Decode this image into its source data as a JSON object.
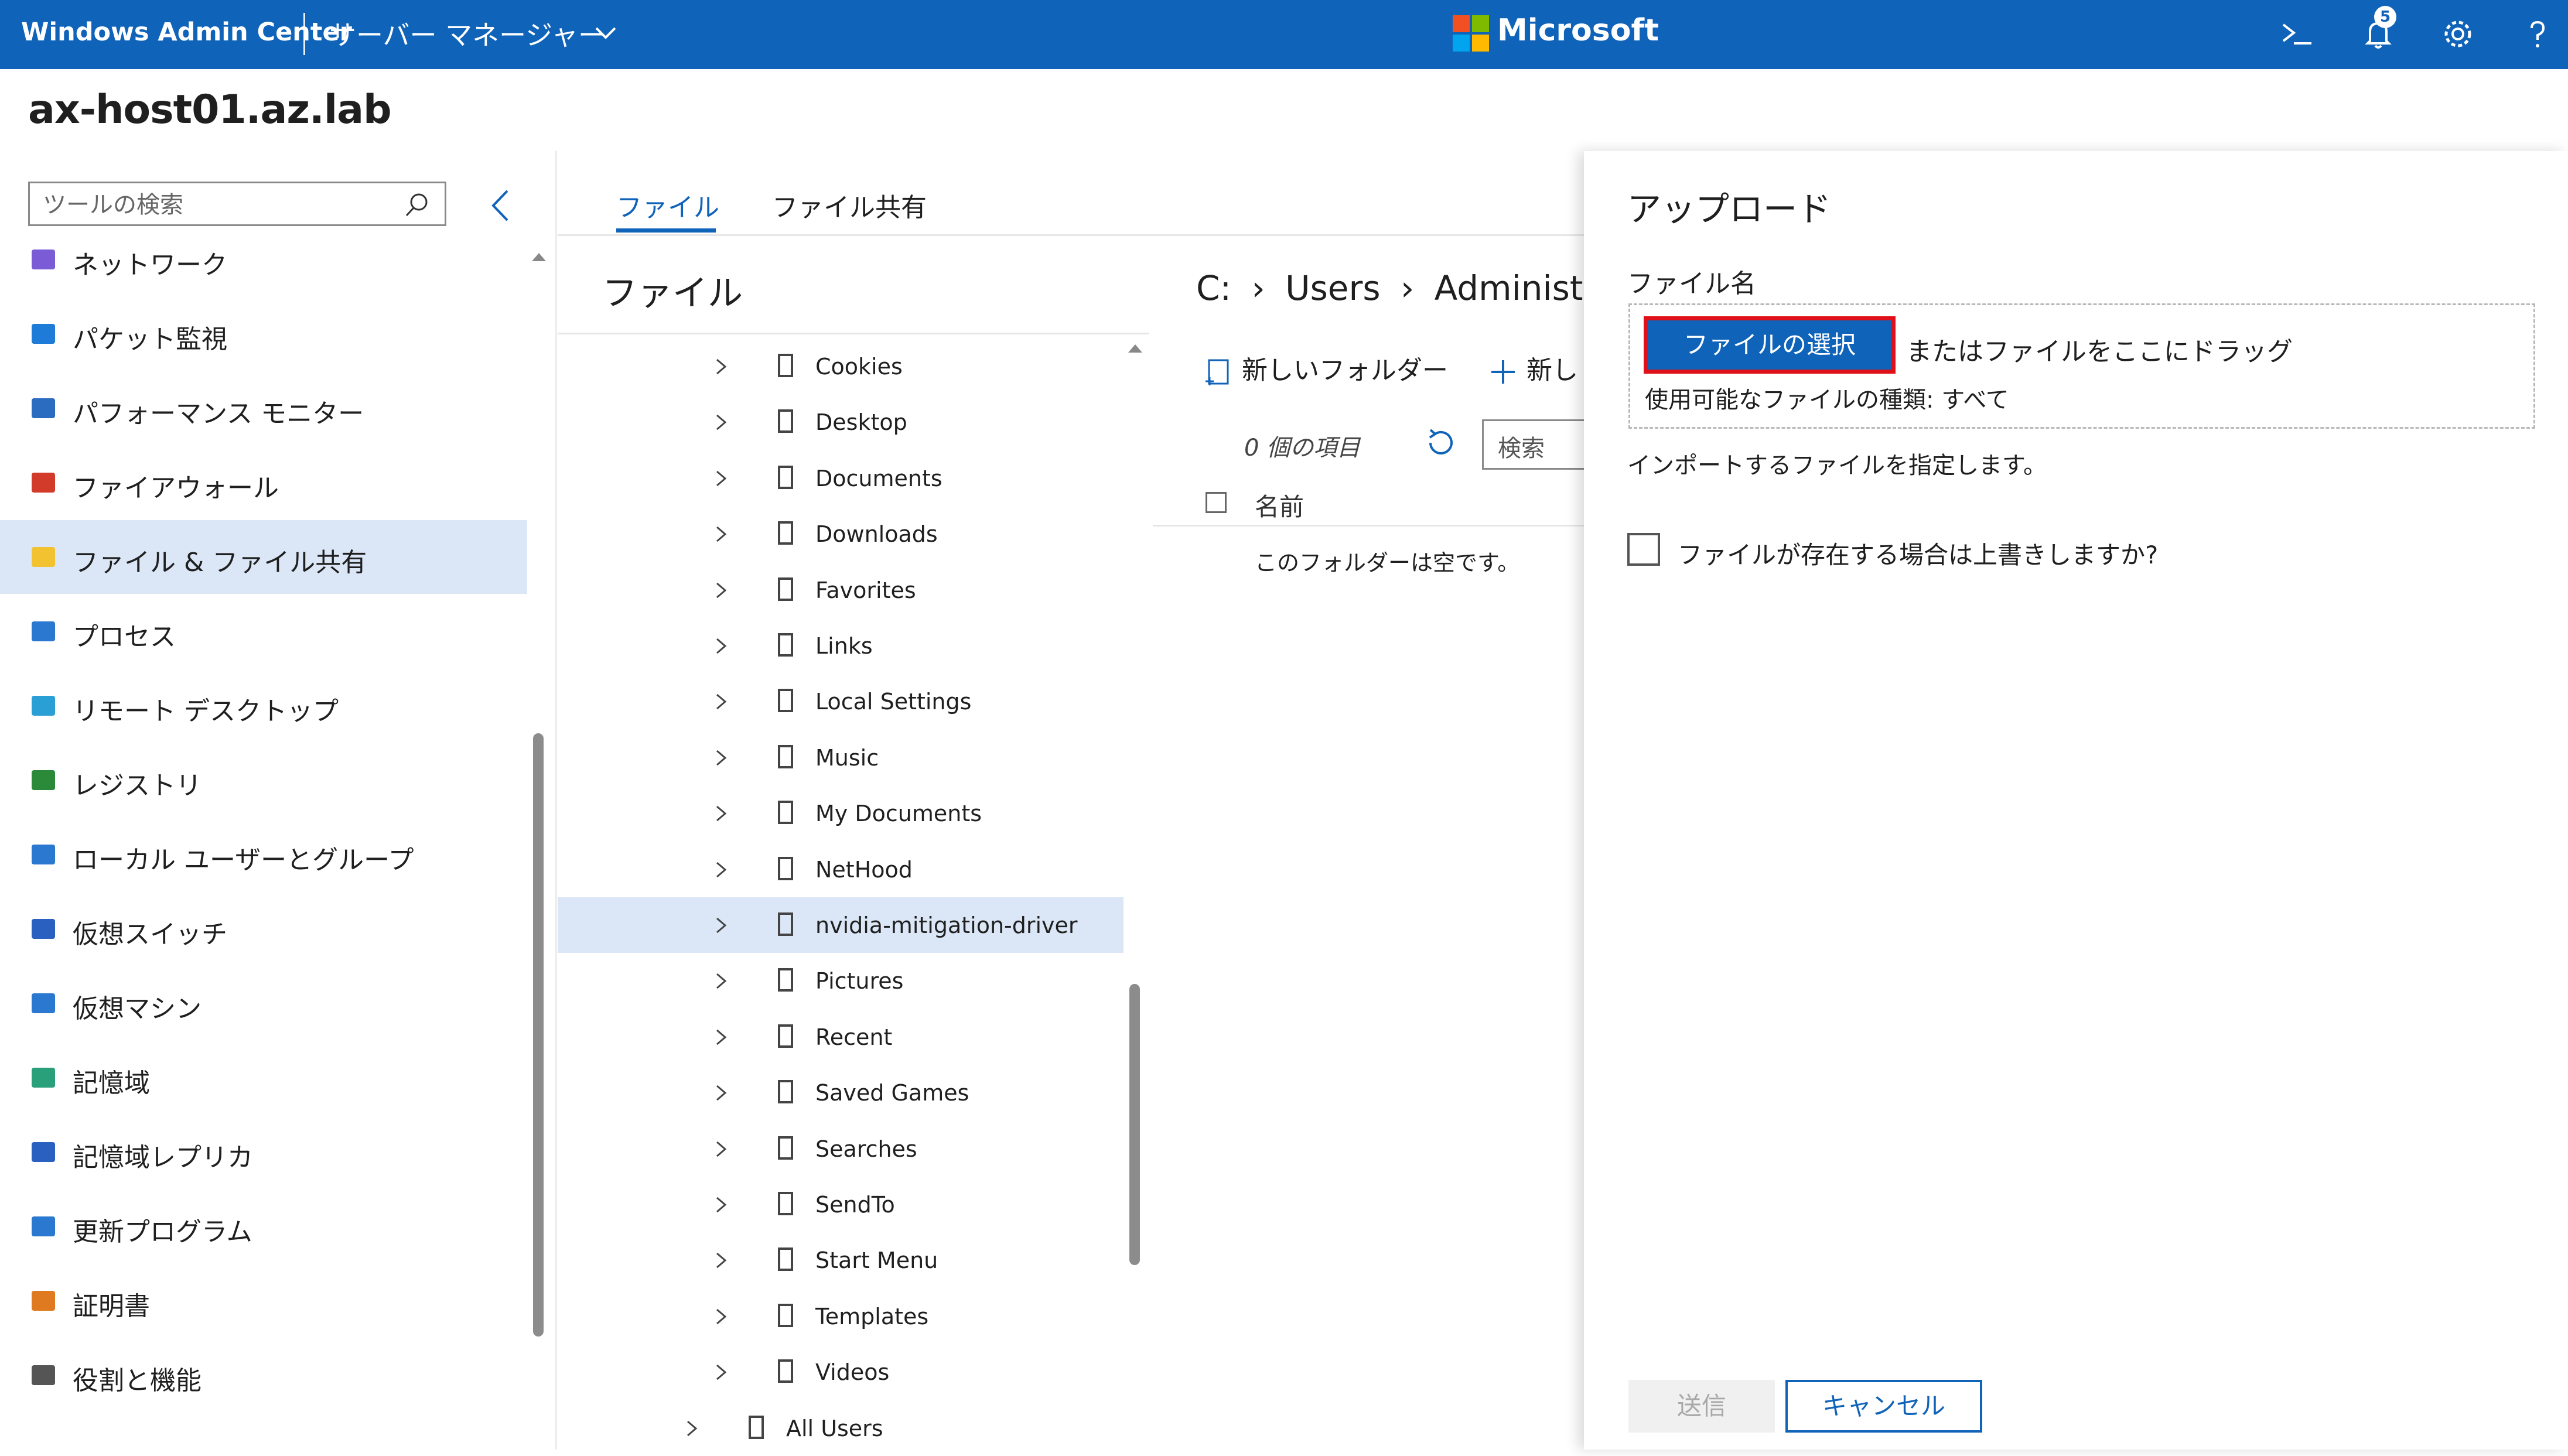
{
  "header": {
    "app_title": "Windows Admin Center",
    "connection": "サーバー マネージャー",
    "brand": "Microsoft",
    "notification_count": "5"
  },
  "host": "ax-host01.az.lab",
  "sidebar": {
    "search_placeholder": "ツールの検索",
    "items": [
      {
        "label": "ネットワーク",
        "icon": "network-icon"
      },
      {
        "label": "パケット監視",
        "icon": "packet-monitor-icon"
      },
      {
        "label": "パフォーマンス モニター",
        "icon": "performance-monitor-icon"
      },
      {
        "label": "ファイアウォール",
        "icon": "firewall-icon"
      },
      {
        "label": "ファイル & ファイル共有",
        "icon": "folder-icon",
        "selected": true
      },
      {
        "label": "プロセス",
        "icon": "process-icon"
      },
      {
        "label": "リモート デスクトップ",
        "icon": "remote-desktop-icon"
      },
      {
        "label": "レジストリ",
        "icon": "registry-icon"
      },
      {
        "label": "ローカル ユーザーとグループ",
        "icon": "users-icon"
      },
      {
        "label": "仮想スイッチ",
        "icon": "virtual-switch-icon"
      },
      {
        "label": "仮想マシン",
        "icon": "virtual-machine-icon"
      },
      {
        "label": "記憶域",
        "icon": "storage-icon"
      },
      {
        "label": "記憶域レプリカ",
        "icon": "storage-replica-icon"
      },
      {
        "label": "更新プログラム",
        "icon": "updates-icon"
      },
      {
        "label": "証明書",
        "icon": "certificate-icon"
      },
      {
        "label": "役割と機能",
        "icon": "roles-features-icon"
      }
    ]
  },
  "tabs": [
    "ファイル",
    "ファイル共有"
  ],
  "tree": {
    "title": "ファイル",
    "items": [
      "Cookies",
      "Desktop",
      "Documents",
      "Downloads",
      "Favorites",
      "Links",
      "Local Settings",
      "Music",
      "My Documents",
      "NetHood",
      "nvidia-mitigation-driver",
      "Pictures",
      "Recent",
      "Saved Games",
      "Searches",
      "SendTo",
      "Start Menu",
      "Templates",
      "Videos"
    ],
    "selected": "nvidia-mitigation-driver",
    "last_item": "All Users"
  },
  "files": {
    "breadcrumb": [
      "C:",
      "Users",
      "Administrator"
    ],
    "new_folder": "新しいフォルダー",
    "new_file": "新し",
    "item_count": "0 個の項目",
    "search_placeholder": "検索",
    "column_name": "名前",
    "empty_message": "このフォルダーは空です。"
  },
  "upload": {
    "title": "アップロード",
    "file_name_label": "ファイル名",
    "choose_button": "ファイルの選択",
    "drag_text": "またはファイルをここにドラッグ",
    "types_text": "使用可能なファイルの種類: すべて",
    "import_help": "インポートするファイルを指定します。",
    "overwrite_label": "ファイルが存在する場合は上書きしますか?",
    "send_button": "送信",
    "cancel_button": "キャンセル"
  },
  "colors": {
    "brand_blue": "#0f63b8",
    "highlight_red": "#e0101b",
    "selection_bg": "#dbe7f6"
  }
}
